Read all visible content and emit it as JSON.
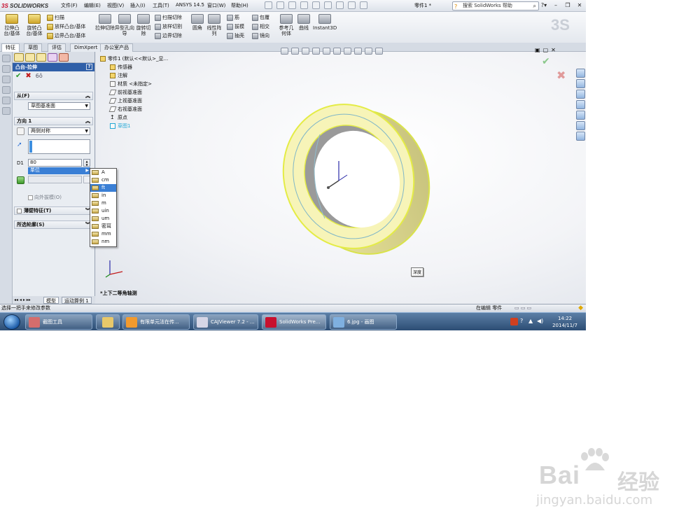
{
  "app": {
    "brand_prefix": "3S",
    "brand_name": "SOLIDWORKS",
    "document_title": "零件1 *"
  },
  "menu": [
    "文件(F)",
    "编辑(E)",
    "视图(V)",
    "插入(I)",
    "工具(T)",
    "ANSYS 14.5",
    "窗口(W)",
    "帮助(H)"
  ],
  "search": {
    "placeholder": "搜索 SolidWorks 帮助"
  },
  "ribbon": {
    "big": [
      "拉伸凸台/基体",
      "旋转凸台/基体",
      "拉伸切除",
      "异型孔向导",
      "旋转切除",
      "圆角",
      "线性阵列",
      "参考几何体",
      "曲线",
      "Instant3D"
    ],
    "small": [
      "扫描",
      "放样凸台/基体",
      "边界凸台/基体",
      "扫描切除",
      "放样切割",
      "边界切除",
      "筋",
      "拔模",
      "抽壳",
      "包覆",
      "相交",
      "镜向"
    ]
  },
  "command_tabs": [
    "特征",
    "草图",
    "评估",
    "DimXpert",
    "办公室产品"
  ],
  "property_manager": {
    "title": "凸台-拉伸",
    "help_label": "?",
    "from_label": "从(F)",
    "from_value": "草图基准面",
    "direction_label": "方向 1",
    "end_condition": "两侧对称",
    "depth_value": "80",
    "unit_bar": "单位",
    "outward_draft": "向外拔模(O)",
    "thin_feature": "薄壁特征(T)",
    "selected_contours": "所选轮廓(S)"
  },
  "unit_options": [
    "A",
    "cm",
    "ft",
    "in",
    "m",
    "uin",
    "um",
    "密耳",
    "mm",
    "nm"
  ],
  "unit_selected": 2,
  "bottom_tabs": [
    "模型",
    "运动算例 1"
  ],
  "tree": {
    "root": "零件1 (默认<<默认>_显...",
    "items": [
      "传感器",
      "注解",
      "材质 <未指定>",
      "前视基准面",
      "上视基准面",
      "右视基准面",
      "原点",
      "草图1"
    ]
  },
  "graphics": {
    "depth_tag": "深度",
    "view_name": "*上下二等角轴测"
  },
  "status": {
    "left": "选择一把手来修改参数",
    "right": "在编辑 零件"
  },
  "taskbar": {
    "tasks": [
      "截图工具",
      "",
      "有限单元法在传...",
      "CAJViewer 7.2 - ...",
      "SolidWorks Pre...",
      "6.jpg - 画图"
    ],
    "time": "14:22",
    "date": "2014/11/7"
  },
  "watermark": {
    "brand": "Bai",
    "brand_cn": "经验",
    "url": "jingyan.baidu.com"
  },
  "colors": {
    "selection_blue": "#3a7fd5",
    "ring_yellow": "#f4ef9c",
    "pm_header": "#2f5fa8"
  }
}
